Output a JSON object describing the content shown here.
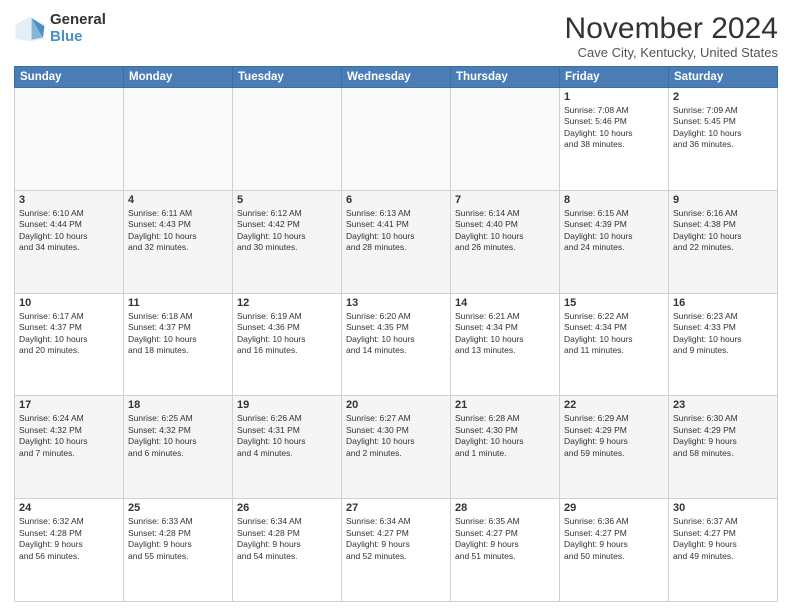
{
  "header": {
    "logo_general": "General",
    "logo_blue": "Blue",
    "title": "November 2024",
    "subtitle": "Cave City, Kentucky, United States"
  },
  "days_of_week": [
    "Sunday",
    "Monday",
    "Tuesday",
    "Wednesday",
    "Thursday",
    "Friday",
    "Saturday"
  ],
  "weeks": [
    [
      {
        "day": "",
        "info": ""
      },
      {
        "day": "",
        "info": ""
      },
      {
        "day": "",
        "info": ""
      },
      {
        "day": "",
        "info": ""
      },
      {
        "day": "",
        "info": ""
      },
      {
        "day": "1",
        "info": "Sunrise: 7:08 AM\nSunset: 5:46 PM\nDaylight: 10 hours\nand 38 minutes."
      },
      {
        "day": "2",
        "info": "Sunrise: 7:09 AM\nSunset: 5:45 PM\nDaylight: 10 hours\nand 36 minutes."
      }
    ],
    [
      {
        "day": "3",
        "info": "Sunrise: 6:10 AM\nSunset: 4:44 PM\nDaylight: 10 hours\nand 34 minutes."
      },
      {
        "day": "4",
        "info": "Sunrise: 6:11 AM\nSunset: 4:43 PM\nDaylight: 10 hours\nand 32 minutes."
      },
      {
        "day": "5",
        "info": "Sunrise: 6:12 AM\nSunset: 4:42 PM\nDaylight: 10 hours\nand 30 minutes."
      },
      {
        "day": "6",
        "info": "Sunrise: 6:13 AM\nSunset: 4:41 PM\nDaylight: 10 hours\nand 28 minutes."
      },
      {
        "day": "7",
        "info": "Sunrise: 6:14 AM\nSunset: 4:40 PM\nDaylight: 10 hours\nand 26 minutes."
      },
      {
        "day": "8",
        "info": "Sunrise: 6:15 AM\nSunset: 4:39 PM\nDaylight: 10 hours\nand 24 minutes."
      },
      {
        "day": "9",
        "info": "Sunrise: 6:16 AM\nSunset: 4:38 PM\nDaylight: 10 hours\nand 22 minutes."
      }
    ],
    [
      {
        "day": "10",
        "info": "Sunrise: 6:17 AM\nSunset: 4:37 PM\nDaylight: 10 hours\nand 20 minutes."
      },
      {
        "day": "11",
        "info": "Sunrise: 6:18 AM\nSunset: 4:37 PM\nDaylight: 10 hours\nand 18 minutes."
      },
      {
        "day": "12",
        "info": "Sunrise: 6:19 AM\nSunset: 4:36 PM\nDaylight: 10 hours\nand 16 minutes."
      },
      {
        "day": "13",
        "info": "Sunrise: 6:20 AM\nSunset: 4:35 PM\nDaylight: 10 hours\nand 14 minutes."
      },
      {
        "day": "14",
        "info": "Sunrise: 6:21 AM\nSunset: 4:34 PM\nDaylight: 10 hours\nand 13 minutes."
      },
      {
        "day": "15",
        "info": "Sunrise: 6:22 AM\nSunset: 4:34 PM\nDaylight: 10 hours\nand 11 minutes."
      },
      {
        "day": "16",
        "info": "Sunrise: 6:23 AM\nSunset: 4:33 PM\nDaylight: 10 hours\nand 9 minutes."
      }
    ],
    [
      {
        "day": "17",
        "info": "Sunrise: 6:24 AM\nSunset: 4:32 PM\nDaylight: 10 hours\nand 7 minutes."
      },
      {
        "day": "18",
        "info": "Sunrise: 6:25 AM\nSunset: 4:32 PM\nDaylight: 10 hours\nand 6 minutes."
      },
      {
        "day": "19",
        "info": "Sunrise: 6:26 AM\nSunset: 4:31 PM\nDaylight: 10 hours\nand 4 minutes."
      },
      {
        "day": "20",
        "info": "Sunrise: 6:27 AM\nSunset: 4:30 PM\nDaylight: 10 hours\nand 2 minutes."
      },
      {
        "day": "21",
        "info": "Sunrise: 6:28 AM\nSunset: 4:30 PM\nDaylight: 10 hours\nand 1 minute."
      },
      {
        "day": "22",
        "info": "Sunrise: 6:29 AM\nSunset: 4:29 PM\nDaylight: 9 hours\nand 59 minutes."
      },
      {
        "day": "23",
        "info": "Sunrise: 6:30 AM\nSunset: 4:29 PM\nDaylight: 9 hours\nand 58 minutes."
      }
    ],
    [
      {
        "day": "24",
        "info": "Sunrise: 6:32 AM\nSunset: 4:28 PM\nDaylight: 9 hours\nand 56 minutes."
      },
      {
        "day": "25",
        "info": "Sunrise: 6:33 AM\nSunset: 4:28 PM\nDaylight: 9 hours\nand 55 minutes."
      },
      {
        "day": "26",
        "info": "Sunrise: 6:34 AM\nSunset: 4:28 PM\nDaylight: 9 hours\nand 54 minutes."
      },
      {
        "day": "27",
        "info": "Sunrise: 6:34 AM\nSunset: 4:27 PM\nDaylight: 9 hours\nand 52 minutes."
      },
      {
        "day": "28",
        "info": "Sunrise: 6:35 AM\nSunset: 4:27 PM\nDaylight: 9 hours\nand 51 minutes."
      },
      {
        "day": "29",
        "info": "Sunrise: 6:36 AM\nSunset: 4:27 PM\nDaylight: 9 hours\nand 50 minutes."
      },
      {
        "day": "30",
        "info": "Sunrise: 6:37 AM\nSunset: 4:27 PM\nDaylight: 9 hours\nand 49 minutes."
      }
    ]
  ]
}
